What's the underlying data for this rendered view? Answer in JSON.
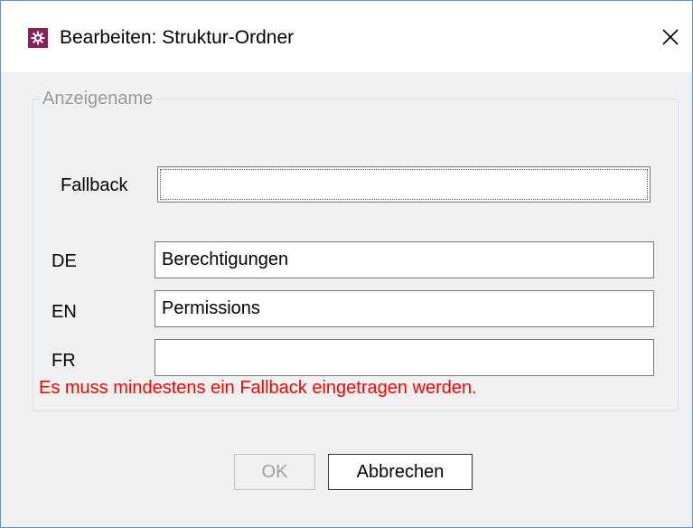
{
  "window": {
    "title": "Bearbeiten: Struktur-Ordner",
    "icon": "gear-icon",
    "close_icon": "close-icon",
    "accent_color": "#8b1e5c"
  },
  "group": {
    "legend": "Anzeigename"
  },
  "fields": {
    "fallback": {
      "label": "Fallback",
      "value": ""
    },
    "de": {
      "label": "DE",
      "value": "Berechtigungen"
    },
    "en": {
      "label": "EN",
      "value": "Permissions"
    },
    "fr": {
      "label": "FR",
      "value": ""
    }
  },
  "error": {
    "message": "Es muss mindestens ein Fallback eingetragen werden.",
    "color": "#ff0000"
  },
  "buttons": {
    "ok": "OK",
    "cancel": "Abbrechen"
  }
}
